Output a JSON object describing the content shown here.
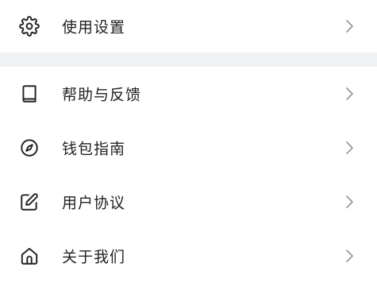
{
  "settings_list": {
    "top_items": [
      {
        "label": "使用设置",
        "icon": "gear-icon"
      }
    ],
    "items": [
      {
        "label": "帮助与反馈",
        "icon": "book-icon"
      },
      {
        "label": "钱包指南",
        "icon": "compass-icon"
      },
      {
        "label": "用户协议",
        "icon": "edit-icon"
      },
      {
        "label": "关于我们",
        "icon": "home-icon"
      }
    ]
  },
  "colors": {
    "text": "#222222",
    "icon": "#222222",
    "chevron": "#9a9a9a",
    "divider": "#f1f2f4",
    "background": "#ffffff"
  }
}
